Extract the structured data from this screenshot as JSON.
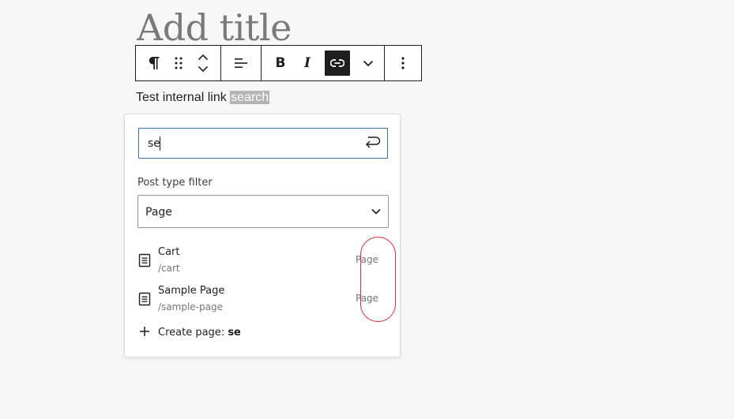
{
  "editor": {
    "title_placeholder": "Add title",
    "paragraph_text": "Test internal link ",
    "selected_text": "search"
  },
  "toolbar": {
    "items": [
      {
        "name": "paragraph-icon"
      },
      {
        "name": "drag-handle-icon"
      },
      {
        "name": "move-up-down-icon"
      },
      {
        "name": "align-icon"
      },
      {
        "name": "bold-icon",
        "glyph": "B"
      },
      {
        "name": "italic-icon",
        "glyph": "I"
      },
      {
        "name": "link-icon",
        "active": true
      },
      {
        "name": "chevron-down-icon"
      },
      {
        "name": "more-options-icon"
      }
    ]
  },
  "link_popover": {
    "search_value": "se",
    "filter_label": "Post type filter",
    "filter_selected": "Page",
    "results": [
      {
        "title": "Cart",
        "url": "/cart",
        "type": "Page"
      },
      {
        "title": "Sample Page",
        "url": "/sample-page",
        "type": "Page"
      }
    ],
    "create_label": "Create page: ",
    "create_term": "se"
  },
  "colors": {
    "annotation": "#e0343c",
    "focus_border": "#3870a8",
    "active_button": "#1e1e1e"
  }
}
